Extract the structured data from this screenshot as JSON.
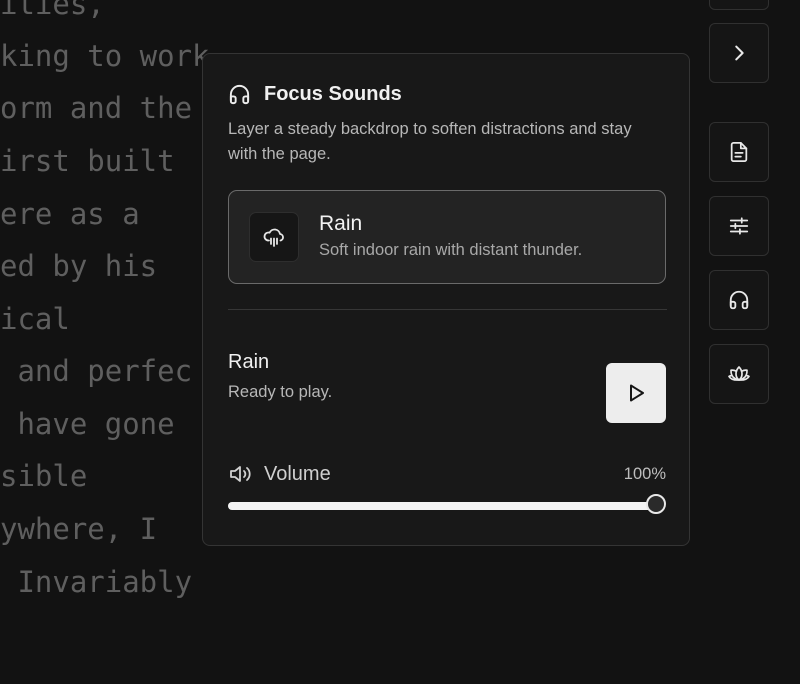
{
  "background_text": [
    "ities,",
    "king to work",
    "orm and the",
    "irst built",
    "ere as a",
    "ed by his",
    "ical",
    " and perfec",
    " have gone",
    "sible",
    "ywhere, I",
    " Invariably"
  ],
  "panel": {
    "title": "Focus Sounds",
    "description": "Layer a steady backdrop to soften distractions and stay with the page.",
    "sound": {
      "name": "Rain",
      "description": "Soft indoor rain with distant thunder.",
      "icon": "cloud-rain-icon"
    },
    "now_playing": {
      "title": "Rain",
      "status": "Ready to play."
    },
    "volume": {
      "label": "Volume",
      "value_text": "100%",
      "level": 1.0
    }
  },
  "sidebar": {
    "buttons": [
      "chevron-right-icon",
      "document-icon",
      "sliders-icon",
      "headphones-icon",
      "lotus-icon"
    ]
  },
  "colors": {
    "background": "#121212",
    "panel": "#181818",
    "accent": "#f4f4f4"
  }
}
